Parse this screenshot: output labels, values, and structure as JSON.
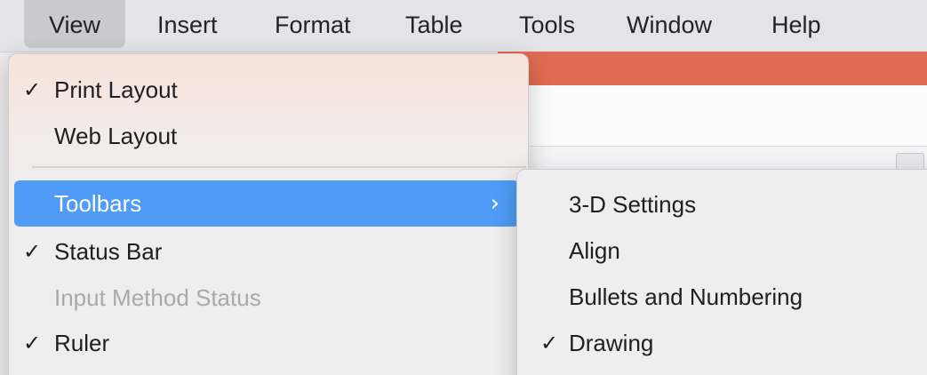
{
  "menubar": {
    "items": [
      {
        "label": "View",
        "active": true
      },
      {
        "label": "Insert"
      },
      {
        "label": "Format"
      },
      {
        "label": "Table"
      },
      {
        "label": "Tools"
      },
      {
        "label": "Window"
      },
      {
        "label": "Help"
      }
    ]
  },
  "view_menu": {
    "items": [
      {
        "label": "Print Layout",
        "checked": true,
        "check_glyph": "✓"
      },
      {
        "label": "Web Layout",
        "checked": false
      },
      {
        "label": "Toolbars",
        "highlighted": true,
        "submenu_indicator": "›"
      },
      {
        "label": "Status Bar",
        "checked": true,
        "check_glyph": "✓"
      },
      {
        "label": "Input Method Status",
        "disabled": true
      },
      {
        "label": "Ruler",
        "checked": true,
        "check_glyph": "✓"
      }
    ]
  },
  "toolbars_submenu": {
    "items": [
      {
        "label": "3-D Settings",
        "checked": false
      },
      {
        "label": "Align",
        "checked": false
      },
      {
        "label": "Bullets and Numbering",
        "checked": false
      },
      {
        "label": "Drawing",
        "checked": true,
        "check_glyph": "✓"
      }
    ]
  },
  "colors": {
    "highlight": "#4f9bf6",
    "doc_titlebar": "#df6b51",
    "disabled_text": "#a9a9ad"
  },
  "icons": {
    "check": "checkmark-icon",
    "submenu": "chevron-right-icon"
  }
}
